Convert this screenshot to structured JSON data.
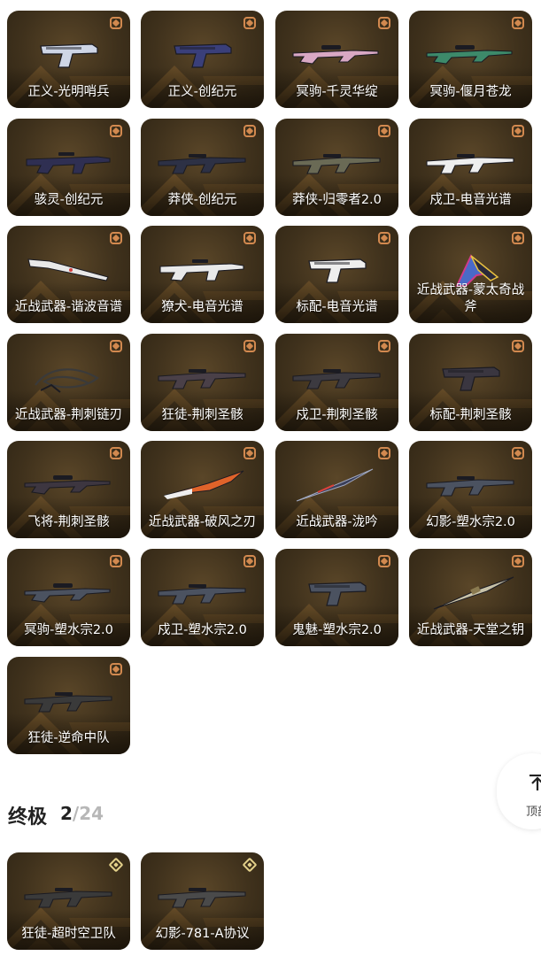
{
  "skins": [
    {
      "label": "正义-光明哨兵",
      "tier": "premium",
      "gun": "pistol",
      "color": "#cfd6e6"
    },
    {
      "label": "正义-创纪元",
      "tier": "premium",
      "gun": "pistol",
      "color": "#3a3f7a"
    },
    {
      "label": "冥驹-千灵华绽",
      "tier": "premium",
      "gun": "sniper",
      "color": "#d9a8c4"
    },
    {
      "label": "冥驹-偃月苍龙",
      "tier": "premium",
      "gun": "sniper",
      "color": "#3d8a6a"
    },
    {
      "label": "骇灵-创纪元",
      "tier": "premium",
      "gun": "smg",
      "color": "#2f2f52"
    },
    {
      "label": "莽侠-创纪元",
      "tier": "premium",
      "gun": "rifle",
      "color": "#2d3145"
    },
    {
      "label": "莽侠-归零者2.0",
      "tier": "premium",
      "gun": "rifle",
      "color": "#6a6a55"
    },
    {
      "label": "戍卫-电音光谱",
      "tier": "premium",
      "gun": "rifle",
      "color": "#eeeeee"
    },
    {
      "label": "近战武器-谐波音谱",
      "tier": "premium",
      "gun": "melee",
      "color": "#e8e8e8"
    },
    {
      "label": "獠犬-电音光谱",
      "tier": "premium",
      "gun": "smg",
      "color": "#e9e9e9"
    },
    {
      "label": "标配-电音光谱",
      "tier": "premium",
      "gun": "pistol",
      "color": "#eeeeee"
    },
    {
      "label": "近战武器-蒙太奇战斧",
      "tier": "premium",
      "gun": "axe",
      "color": "#4a6ac8"
    },
    {
      "label": "近战武器-荆刺链刃",
      "tier": "premium",
      "gun": "chain",
      "color": "#3a3a3a"
    },
    {
      "label": "狂徒-荆刺圣骸",
      "tier": "premium",
      "gun": "rifle",
      "color": "#4a4048"
    },
    {
      "label": "戍卫-荆刺圣骸",
      "tier": "premium",
      "gun": "rifle",
      "color": "#3c3a40"
    },
    {
      "label": "标配-荆刺圣骸",
      "tier": "premium",
      "gun": "pistol",
      "color": "#3a3640"
    },
    {
      "label": "飞将-荆刺圣骸",
      "tier": "premium",
      "gun": "sniper",
      "color": "#3d3640"
    },
    {
      "label": "近战武器-破风之刃",
      "tier": "premium",
      "gun": "blade",
      "color": "#e0632a"
    },
    {
      "label": "近战武器-泷吟",
      "tier": "premium",
      "gun": "kunai",
      "color": "#3a3f5a"
    },
    {
      "label": "幻影-塑水宗2.0",
      "tier": "premium",
      "gun": "rifle",
      "color": "#4b5260"
    },
    {
      "label": "冥驹-塑水宗2.0",
      "tier": "premium",
      "gun": "sniper",
      "color": "#4b5260"
    },
    {
      "label": "戍卫-塑水宗2.0",
      "tier": "premium",
      "gun": "rifle",
      "color": "#4b5260"
    },
    {
      "label": "鬼魅-塑水宗2.0",
      "tier": "premium",
      "gun": "pistol",
      "color": "#4b5260"
    },
    {
      "label": "近战武器-天堂之钥",
      "tier": "premium",
      "gun": "dagger",
      "color": "#c8c2a8"
    },
    {
      "label": "狂徒-逆命中队",
      "tier": "premium",
      "gun": "rifle",
      "color": "#3a3a3a"
    }
  ],
  "section": {
    "title": "终极",
    "count": "2",
    "total": "/24"
  },
  "ultra_skins": [
    {
      "label": "狂徒-超时空卫队",
      "tier": "ultra",
      "gun": "rifle",
      "color": "#3a3a3a"
    },
    {
      "label": "幻影-781-A协议",
      "tier": "ultra",
      "gun": "rifle",
      "color": "#4a4a4a"
    }
  ],
  "top_button": {
    "label": "顶部"
  },
  "colors": {
    "card_bg": "#3f311c",
    "chevron": "#7a5a2c",
    "premium_badge": "#d2894f",
    "ultra_badge": "#e3d08a"
  }
}
